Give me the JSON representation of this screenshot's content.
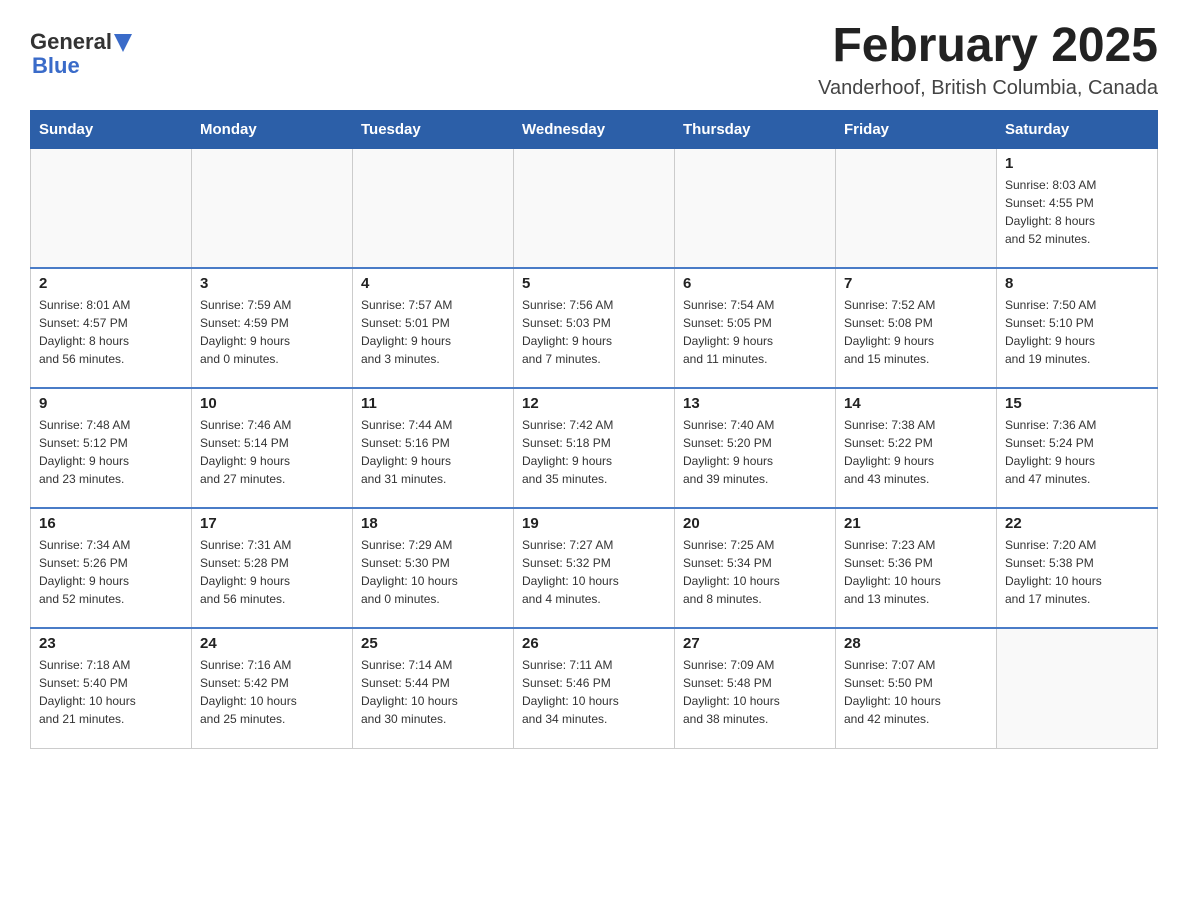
{
  "logo": {
    "text_general": "General",
    "text_blue": "Blue",
    "arrow": "▲"
  },
  "title": "February 2025",
  "subtitle": "Vanderhoof, British Columbia, Canada",
  "days_of_week": [
    "Sunday",
    "Monday",
    "Tuesday",
    "Wednesday",
    "Thursday",
    "Friday",
    "Saturday"
  ],
  "weeks": [
    [
      {
        "day": "",
        "info": ""
      },
      {
        "day": "",
        "info": ""
      },
      {
        "day": "",
        "info": ""
      },
      {
        "day": "",
        "info": ""
      },
      {
        "day": "",
        "info": ""
      },
      {
        "day": "",
        "info": ""
      },
      {
        "day": "1",
        "info": "Sunrise: 8:03 AM\nSunset: 4:55 PM\nDaylight: 8 hours\nand 52 minutes."
      }
    ],
    [
      {
        "day": "2",
        "info": "Sunrise: 8:01 AM\nSunset: 4:57 PM\nDaylight: 8 hours\nand 56 minutes."
      },
      {
        "day": "3",
        "info": "Sunrise: 7:59 AM\nSunset: 4:59 PM\nDaylight: 9 hours\nand 0 minutes."
      },
      {
        "day": "4",
        "info": "Sunrise: 7:57 AM\nSunset: 5:01 PM\nDaylight: 9 hours\nand 3 minutes."
      },
      {
        "day": "5",
        "info": "Sunrise: 7:56 AM\nSunset: 5:03 PM\nDaylight: 9 hours\nand 7 minutes."
      },
      {
        "day": "6",
        "info": "Sunrise: 7:54 AM\nSunset: 5:05 PM\nDaylight: 9 hours\nand 11 minutes."
      },
      {
        "day": "7",
        "info": "Sunrise: 7:52 AM\nSunset: 5:08 PM\nDaylight: 9 hours\nand 15 minutes."
      },
      {
        "day": "8",
        "info": "Sunrise: 7:50 AM\nSunset: 5:10 PM\nDaylight: 9 hours\nand 19 minutes."
      }
    ],
    [
      {
        "day": "9",
        "info": "Sunrise: 7:48 AM\nSunset: 5:12 PM\nDaylight: 9 hours\nand 23 minutes."
      },
      {
        "day": "10",
        "info": "Sunrise: 7:46 AM\nSunset: 5:14 PM\nDaylight: 9 hours\nand 27 minutes."
      },
      {
        "day": "11",
        "info": "Sunrise: 7:44 AM\nSunset: 5:16 PM\nDaylight: 9 hours\nand 31 minutes."
      },
      {
        "day": "12",
        "info": "Sunrise: 7:42 AM\nSunset: 5:18 PM\nDaylight: 9 hours\nand 35 minutes."
      },
      {
        "day": "13",
        "info": "Sunrise: 7:40 AM\nSunset: 5:20 PM\nDaylight: 9 hours\nand 39 minutes."
      },
      {
        "day": "14",
        "info": "Sunrise: 7:38 AM\nSunset: 5:22 PM\nDaylight: 9 hours\nand 43 minutes."
      },
      {
        "day": "15",
        "info": "Sunrise: 7:36 AM\nSunset: 5:24 PM\nDaylight: 9 hours\nand 47 minutes."
      }
    ],
    [
      {
        "day": "16",
        "info": "Sunrise: 7:34 AM\nSunset: 5:26 PM\nDaylight: 9 hours\nand 52 minutes."
      },
      {
        "day": "17",
        "info": "Sunrise: 7:31 AM\nSunset: 5:28 PM\nDaylight: 9 hours\nand 56 minutes."
      },
      {
        "day": "18",
        "info": "Sunrise: 7:29 AM\nSunset: 5:30 PM\nDaylight: 10 hours\nand 0 minutes."
      },
      {
        "day": "19",
        "info": "Sunrise: 7:27 AM\nSunset: 5:32 PM\nDaylight: 10 hours\nand 4 minutes."
      },
      {
        "day": "20",
        "info": "Sunrise: 7:25 AM\nSunset: 5:34 PM\nDaylight: 10 hours\nand 8 minutes."
      },
      {
        "day": "21",
        "info": "Sunrise: 7:23 AM\nSunset: 5:36 PM\nDaylight: 10 hours\nand 13 minutes."
      },
      {
        "day": "22",
        "info": "Sunrise: 7:20 AM\nSunset: 5:38 PM\nDaylight: 10 hours\nand 17 minutes."
      }
    ],
    [
      {
        "day": "23",
        "info": "Sunrise: 7:18 AM\nSunset: 5:40 PM\nDaylight: 10 hours\nand 21 minutes."
      },
      {
        "day": "24",
        "info": "Sunrise: 7:16 AM\nSunset: 5:42 PM\nDaylight: 10 hours\nand 25 minutes."
      },
      {
        "day": "25",
        "info": "Sunrise: 7:14 AM\nSunset: 5:44 PM\nDaylight: 10 hours\nand 30 minutes."
      },
      {
        "day": "26",
        "info": "Sunrise: 7:11 AM\nSunset: 5:46 PM\nDaylight: 10 hours\nand 34 minutes."
      },
      {
        "day": "27",
        "info": "Sunrise: 7:09 AM\nSunset: 5:48 PM\nDaylight: 10 hours\nand 38 minutes."
      },
      {
        "day": "28",
        "info": "Sunrise: 7:07 AM\nSunset: 5:50 PM\nDaylight: 10 hours\nand 42 minutes."
      },
      {
        "day": "",
        "info": ""
      }
    ]
  ]
}
